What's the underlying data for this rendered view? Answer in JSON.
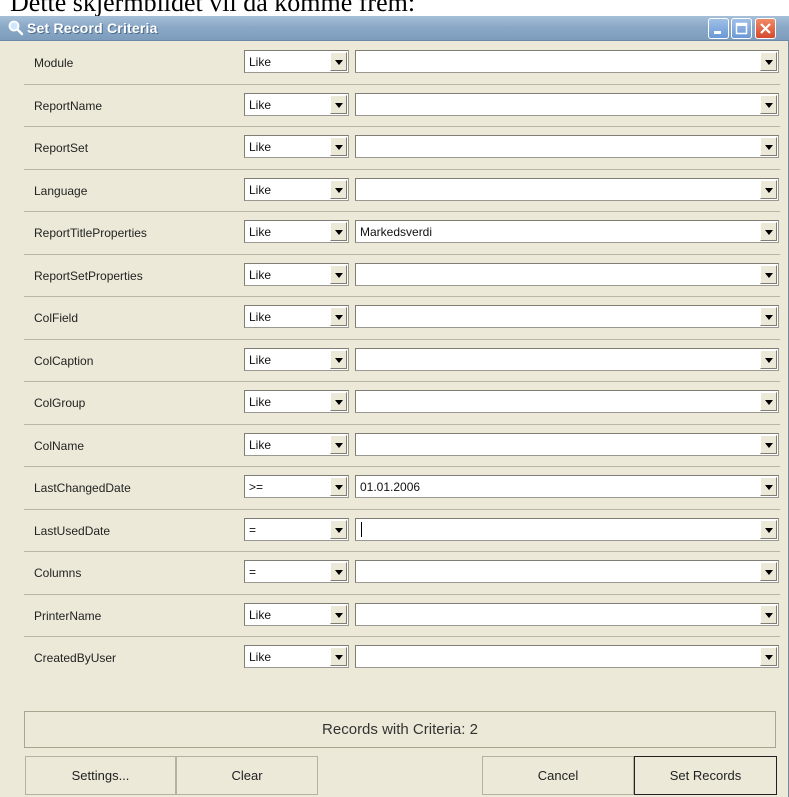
{
  "doc_text": "Dette skjermbildet vil da komme frem:",
  "window": {
    "title": "Set Record Criteria"
  },
  "rows": [
    {
      "field": "Module",
      "op": "Like",
      "value": ""
    },
    {
      "field": "ReportName",
      "op": "Like",
      "value": ""
    },
    {
      "field": "ReportSet",
      "op": "Like",
      "value": ""
    },
    {
      "field": "Language",
      "op": "Like",
      "value": ""
    },
    {
      "field": "ReportTitleProperties",
      "op": "Like",
      "value": "Markedsverdi"
    },
    {
      "field": "ReportSetProperties",
      "op": "Like",
      "value": ""
    },
    {
      "field": "ColField",
      "op": "Like",
      "value": ""
    },
    {
      "field": "ColCaption",
      "op": "Like",
      "value": ""
    },
    {
      "field": "ColGroup",
      "op": "Like",
      "value": ""
    },
    {
      "field": "ColName",
      "op": "Like",
      "value": ""
    },
    {
      "field": "LastChangedDate",
      "op": ">=",
      "value": "01.01.2006"
    },
    {
      "field": "LastUsedDate",
      "op": "=",
      "value": ""
    },
    {
      "field": "Columns",
      "op": "=",
      "value": ""
    },
    {
      "field": "PrinterName",
      "op": "Like",
      "value": ""
    },
    {
      "field": "CreatedByUser",
      "op": "Like",
      "value": ""
    }
  ],
  "status": "Records with Criteria: 2",
  "buttons": {
    "settings": "Settings...",
    "clear": "Clear",
    "cancel": "Cancel",
    "set_records": "Set Records"
  }
}
